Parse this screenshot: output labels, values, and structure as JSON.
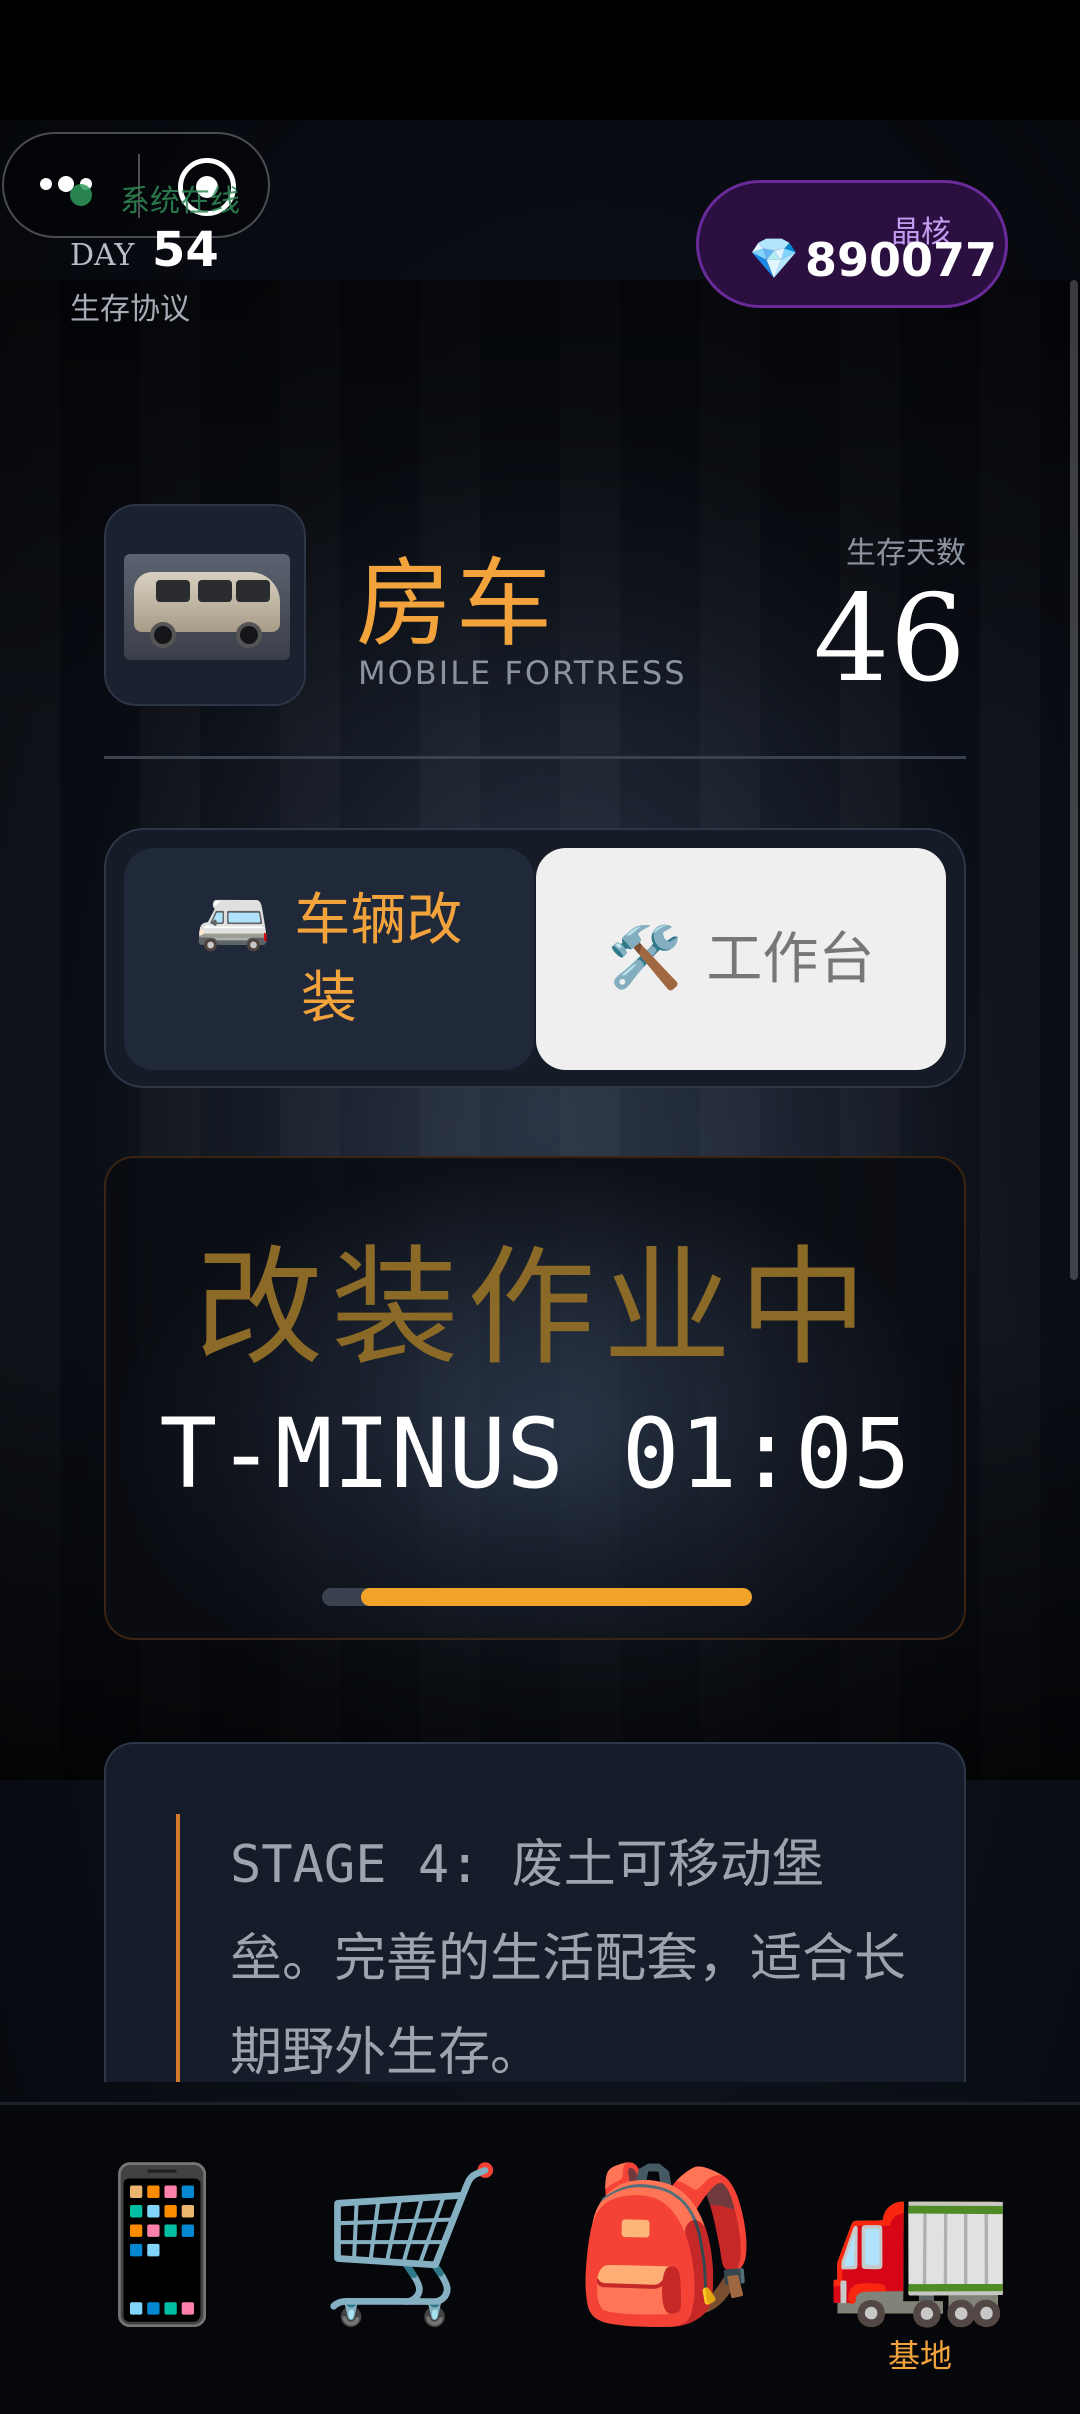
{
  "header": {
    "online_text": "系统在线",
    "day_label": "DAY",
    "day_number": "54",
    "protocol": "生存协议"
  },
  "currency": {
    "label": "晶核",
    "icon": "gem-icon",
    "value": "890077"
  },
  "vehicle": {
    "title": "房车",
    "subtitle": "MOBILE FORTRESS",
    "days_label": "生存天数",
    "days_value": "46"
  },
  "tabs": [
    {
      "icon": "🚐",
      "label": "车辆改装",
      "active": true
    },
    {
      "icon": "🛠️",
      "label": "工作台",
      "active": false
    }
  ],
  "operation": {
    "title": "改装作业中",
    "countdown": "T-MINUS 01:05",
    "progress_start": 0.09,
    "progress_end": 1.0
  },
  "stage": {
    "text": "STAGE 4: 废土可移动堡垒。完善的生活配套，适合长期野外生存。"
  },
  "nav": [
    {
      "icon": "📱",
      "label": ""
    },
    {
      "icon": "🛒",
      "label": ""
    },
    {
      "icon": "🎒",
      "label": ""
    },
    {
      "icon": "🚛",
      "label": "基地"
    }
  ],
  "colors": {
    "accent": "#f2a33c",
    "currency_bg": "#2a0f40",
    "tab_active_bg": "#202939"
  }
}
